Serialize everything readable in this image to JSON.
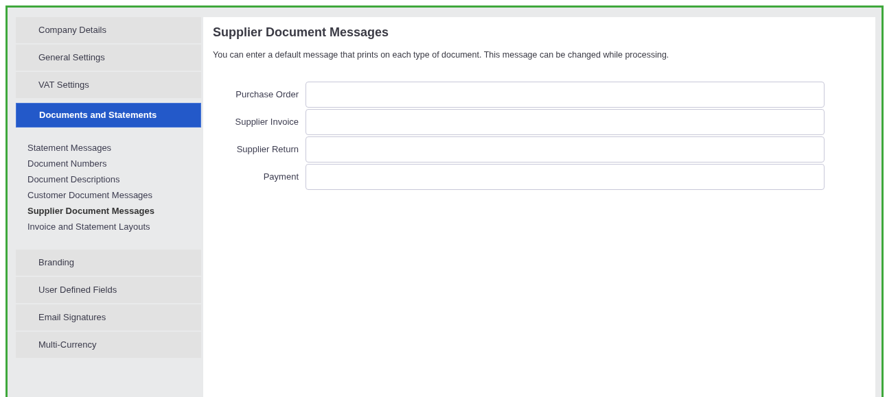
{
  "sidebar": {
    "items": [
      {
        "label": "Company Details",
        "selected": false
      },
      {
        "label": "General Settings",
        "selected": false
      },
      {
        "label": "VAT Settings",
        "selected": false
      },
      {
        "label": "Documents and Statements",
        "selected": true,
        "expanded": true,
        "children": [
          {
            "label": "Statement Messages",
            "selected": false
          },
          {
            "label": "Document Numbers",
            "selected": false
          },
          {
            "label": "Document Descriptions",
            "selected": false
          },
          {
            "label": "Customer Document Messages",
            "selected": false
          },
          {
            "label": "Supplier Document Messages",
            "selected": true
          },
          {
            "label": "Invoice and Statement Layouts",
            "selected": false
          }
        ]
      },
      {
        "label": "Branding",
        "selected": false
      },
      {
        "label": "User Defined Fields",
        "selected": false
      },
      {
        "label": "Email Signatures",
        "selected": false
      },
      {
        "label": "Multi-Currency",
        "selected": false
      }
    ]
  },
  "main": {
    "title": "Supplier Document Messages",
    "description": "You can enter a default message that prints on each type of document. This message can be changed while processing.",
    "fields": [
      {
        "label": "Purchase Order"
      },
      {
        "label": "Supplier Invoice"
      },
      {
        "label": "Supplier Return"
      },
      {
        "label": "Payment"
      }
    ]
  }
}
